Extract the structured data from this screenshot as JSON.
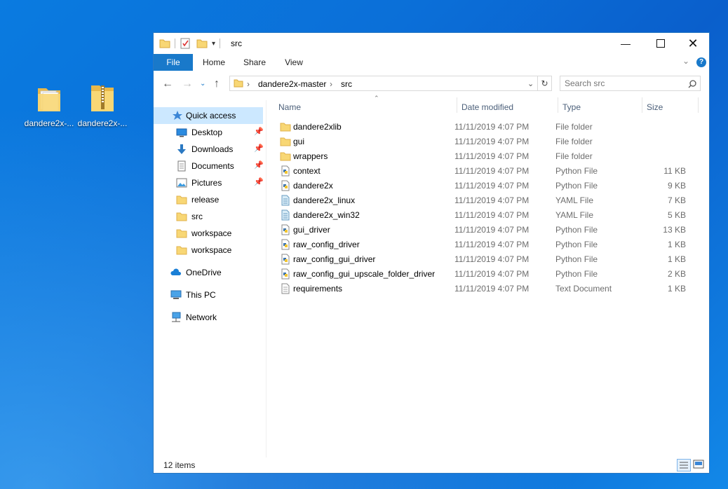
{
  "desktop": {
    "icons": [
      {
        "label": "dandere2x-...",
        "icon": "folder-icon"
      },
      {
        "label": "dandere2x-...",
        "icon": "zip-folder-icon"
      }
    ]
  },
  "window": {
    "title": "src",
    "ribbon_tabs": [
      "File",
      "Home",
      "Share",
      "View"
    ],
    "breadcrumb": [
      "dandere2x-master",
      "src"
    ],
    "search_placeholder": "Search src",
    "nav": {
      "quick_access": "Quick access",
      "pinned": [
        {
          "label": "Desktop",
          "icon": "desktop-icon"
        },
        {
          "label": "Downloads",
          "icon": "download-arrow-icon"
        },
        {
          "label": "Documents",
          "icon": "documents-icon"
        },
        {
          "label": "Pictures",
          "icon": "pictures-icon"
        }
      ],
      "recent": [
        {
          "label": "release",
          "icon": "folder-icon"
        },
        {
          "label": "src",
          "icon": "folder-icon"
        },
        {
          "label": "workspace",
          "icon": "folder-icon"
        },
        {
          "label": "workspace",
          "icon": "folder-icon"
        }
      ],
      "onedrive": "OneDrive",
      "this_pc": "This PC",
      "network": "Network"
    },
    "columns": [
      "Name",
      "Date modified",
      "Type",
      "Size"
    ],
    "files": [
      {
        "name": "dandere2xlib",
        "date": "11/11/2019 4:07 PM",
        "type": "File folder",
        "size": "",
        "icon": "folder-icon"
      },
      {
        "name": "gui",
        "date": "11/11/2019 4:07 PM",
        "type": "File folder",
        "size": "",
        "icon": "folder-icon"
      },
      {
        "name": "wrappers",
        "date": "11/11/2019 4:07 PM",
        "type": "File folder",
        "size": "",
        "icon": "folder-icon"
      },
      {
        "name": "context",
        "date": "11/11/2019 4:07 PM",
        "type": "Python File",
        "size": "11 KB",
        "icon": "python-file-icon"
      },
      {
        "name": "dandere2x",
        "date": "11/11/2019 4:07 PM",
        "type": "Python File",
        "size": "9 KB",
        "icon": "python-file-icon"
      },
      {
        "name": "dandere2x_linux",
        "date": "11/11/2019 4:07 PM",
        "type": "YAML File",
        "size": "7 KB",
        "icon": "yaml-file-icon"
      },
      {
        "name": "dandere2x_win32",
        "date": "11/11/2019 4:07 PM",
        "type": "YAML File",
        "size": "5 KB",
        "icon": "yaml-file-icon"
      },
      {
        "name": "gui_driver",
        "date": "11/11/2019 4:07 PM",
        "type": "Python File",
        "size": "13 KB",
        "icon": "python-file-icon"
      },
      {
        "name": "raw_config_driver",
        "date": "11/11/2019 4:07 PM",
        "type": "Python File",
        "size": "1 KB",
        "icon": "python-file-icon"
      },
      {
        "name": "raw_config_gui_driver",
        "date": "11/11/2019 4:07 PM",
        "type": "Python File",
        "size": "1 KB",
        "icon": "python-file-icon"
      },
      {
        "name": "raw_config_gui_upscale_folder_driver",
        "date": "11/11/2019 4:07 PM",
        "type": "Python File",
        "size": "2 KB",
        "icon": "python-file-icon"
      },
      {
        "name": "requirements",
        "date": "11/11/2019 4:07 PM",
        "type": "Text Document",
        "size": "1 KB",
        "icon": "text-file-icon"
      }
    ],
    "status": "12 items",
    "colors": {
      "accent": "#1979ca",
      "selection": "#cce8ff",
      "folder": "#f8d775"
    }
  }
}
